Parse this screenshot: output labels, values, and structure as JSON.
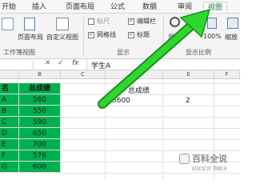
{
  "tabs": [
    {
      "label": "开始"
    },
    {
      "label": "插入"
    },
    {
      "label": "页面布局"
    },
    {
      "label": "公式"
    },
    {
      "label": "数据"
    },
    {
      "label": "审阅"
    },
    {
      "label": "视图"
    }
  ],
  "ribbon": {
    "page_layout_label": "页面布局",
    "custom_view_label": "自定义视图",
    "workbook_views_group": "工作簿视图",
    "show_group": "显示",
    "zoom_group": "显示比例",
    "ruler_label": "标尺",
    "edit_bar_label": "编辑栏",
    "gridlines_label": "网格线",
    "headings_label": "标题",
    "zoom_label": "显示",
    "zoom_100_label": "100%",
    "zoom_selection_label": "缩放"
  },
  "formula_bar": {
    "fx_label": "fx",
    "content": "学生A"
  },
  "columns": [
    "B",
    "C",
    "D",
    "E",
    "F"
  ],
  "sheet": {
    "header_name": "名",
    "header_total": "总成绩",
    "rows": [
      {
        "name": "A",
        "score": "560"
      },
      {
        "name": "B",
        "score": "550"
      },
      {
        "name": "C",
        "score": "590"
      },
      {
        "name": "D",
        "score": "650"
      },
      {
        "name": "E",
        "score": "700"
      },
      {
        "name": "F",
        "score": "576"
      },
      {
        "name": "G",
        "score": "600"
      }
    ],
    "d_header_partial": "总成绩",
    "d_value_partial": "5600",
    "e_value": "2"
  },
  "watermark": {
    "title": "百科全说",
    "subtitle": "轻松知识 得解决"
  },
  "colors": {
    "arrow": "#22cc22",
    "highlight": "#00b050",
    "accent": "#217346"
  }
}
